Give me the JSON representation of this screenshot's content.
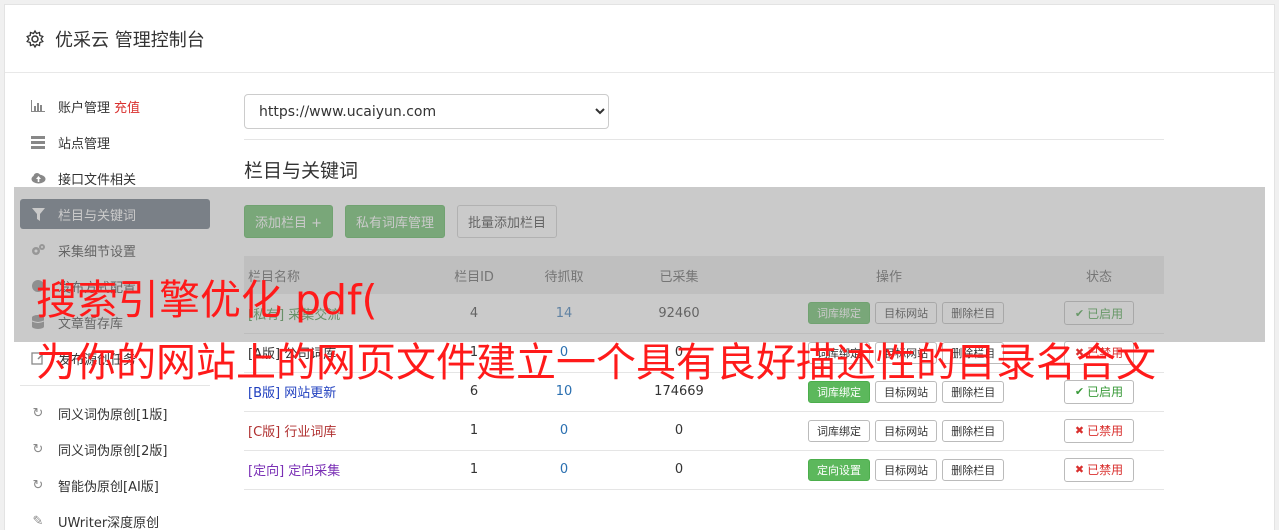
{
  "app": {
    "title": "优采云 管理控制台"
  },
  "sidebar": {
    "items": [
      {
        "label": "账户管理",
        "extra": "充值",
        "icon": "bar-chart-icon"
      },
      {
        "label": "站点管理",
        "icon": "server-icon"
      },
      {
        "label": "接口文件相关",
        "icon": "cloud-upload-icon"
      },
      {
        "label": "栏目与关键词",
        "icon": "filter-icon",
        "active": true
      },
      {
        "label": "采集细节设置",
        "icon": "cogs-icon"
      },
      {
        "label": "发布方式配置",
        "icon": "globe-icon"
      },
      {
        "label": "文章暂存库",
        "icon": "database-icon"
      },
      {
        "label": "发布源创任务",
        "icon": "edit-icon"
      }
    ],
    "tools": [
      {
        "label": "同义词伪原创[1版]",
        "icon": "refresh-icon"
      },
      {
        "label": "同义词伪原创[2版]",
        "icon": "refresh-icon"
      },
      {
        "label": "智能伪原创[AI版]",
        "icon": "refresh-icon"
      },
      {
        "label": "UWriter深度原创",
        "icon": "pencil-icon"
      }
    ]
  },
  "main": {
    "site_select": {
      "value": "https://www.ucaiyun.com"
    },
    "section_title": "栏目与关键词",
    "buttons": {
      "add_column": "添加栏目 +",
      "private_lexicon": "私有词库管理",
      "batch_add": "批量添加栏目"
    },
    "table": {
      "headers": [
        "栏目名称",
        "栏目ID",
        "待抓取",
        "已采集",
        "操作",
        "状态"
      ],
      "rows": [
        {
          "tag": "[私有]",
          "name": "采集交流",
          "id": "4",
          "pending": "14",
          "collected": "92460",
          "op1": "词库绑定",
          "op1_green": true,
          "op2": "目标网站",
          "op3": "删除栏目",
          "status": "已启用",
          "status_on": true,
          "color": "#3a8a3a"
        },
        {
          "tag": "[A版]",
          "name": "公司词库",
          "id": "1",
          "pending": "0",
          "collected": "0",
          "op1": "词库绑定",
          "op1_green": false,
          "op2": "目标网站",
          "op3": "删除栏目",
          "status": "已禁用",
          "status_on": false,
          "color": "#333333"
        },
        {
          "tag": "[B版]",
          "name": "网站更新",
          "id": "6",
          "pending": "10",
          "collected": "174669",
          "op1": "词库绑定",
          "op1_green": true,
          "op2": "目标网站",
          "op3": "删除栏目",
          "status": "已启用",
          "status_on": true,
          "color": "#1f3fbf"
        },
        {
          "tag": "[C版]",
          "name": "行业词库",
          "id": "1",
          "pending": "0",
          "collected": "0",
          "op1": "词库绑定",
          "op1_green": false,
          "op2": "目标网站",
          "op3": "删除栏目",
          "status": "已禁用",
          "status_on": false,
          "color": "#b03030"
        },
        {
          "tag": "[定向]",
          "name": "定向采集",
          "id": "1",
          "pending": "0",
          "collected": "0",
          "op1": "定向设置",
          "op1_green": true,
          "op2": "目标网站",
          "op3": "删除栏目",
          "status": "已禁用",
          "status_on": false,
          "color": "#7a2fb5"
        }
      ]
    }
  },
  "watermark": {
    "line1": "搜索引擎优化 pdf(",
    "line2": "为你的网站上的网页文件建立一个具有良好描述性的目录名合文"
  }
}
